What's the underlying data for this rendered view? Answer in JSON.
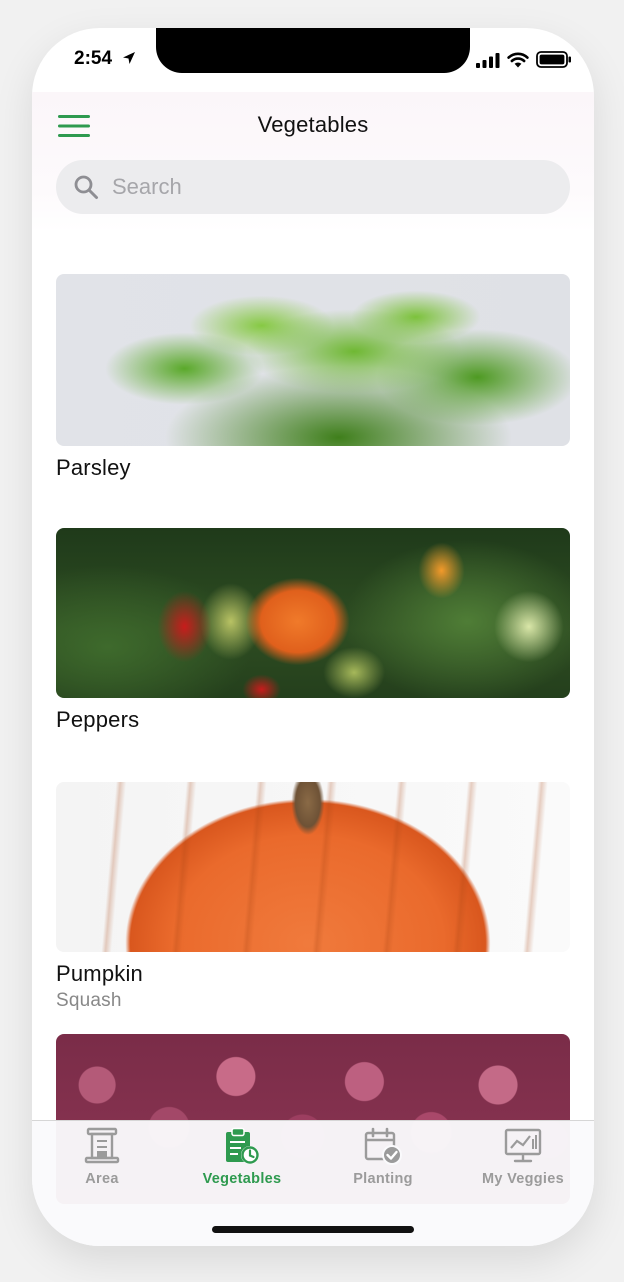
{
  "status_bar": {
    "time": "2:54"
  },
  "header": {
    "title": "Vegetables",
    "menu_icon": "hamburger-icon"
  },
  "search": {
    "placeholder": "Search",
    "value": ""
  },
  "vegetables": [
    {
      "name": "Parsley",
      "subtitle": ""
    },
    {
      "name": "Peppers",
      "subtitle": ""
    },
    {
      "name": "Pumpkin",
      "subtitle": "Squash"
    },
    {
      "name": "",
      "subtitle": ""
    }
  ],
  "tabs": [
    {
      "label": "Area",
      "icon": "area-icon",
      "active": false
    },
    {
      "label": "Vegetables",
      "icon": "vegetables-clipboard-icon",
      "active": true
    },
    {
      "label": "Planting",
      "icon": "planting-calendar-icon",
      "active": false
    },
    {
      "label": "My Veggies",
      "icon": "my-veggies-chart-icon",
      "active": false
    }
  ],
  "colors": {
    "accent": "#2e9a4f",
    "inactive_tab": "#9b9b9b",
    "search_bg": "#ececee"
  }
}
